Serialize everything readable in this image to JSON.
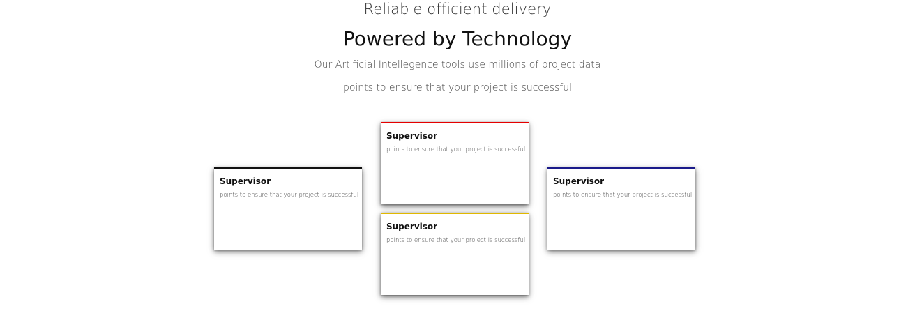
{
  "header": {
    "eyebrow": "Reliable officient delivery",
    "headline": "Powered by Technology",
    "description_line_1": "Our Artificial Intellegence tools use millions of project data",
    "description_line_2": "points to ensure that your project is successful"
  },
  "cards": [
    {
      "title": "Supervisor",
      "text": "points to ensure that your project is successful",
      "accent_color": "#111111"
    },
    {
      "title": "Supervisor",
      "text": "points to ensure that your project is successful",
      "accent_color": "#e60000"
    },
    {
      "title": "Supervisor",
      "text": "points to ensure that your project is successful",
      "accent_color": "#e0b800"
    },
    {
      "title": "Supervisor",
      "text": "points to ensure that your project is successful",
      "accent_color": "#1a1a8a"
    }
  ]
}
